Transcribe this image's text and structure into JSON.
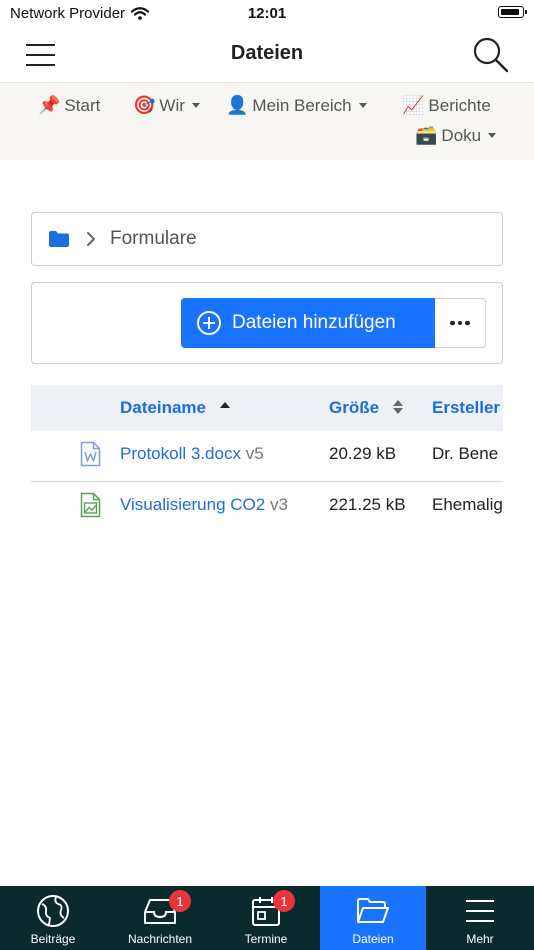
{
  "status_bar": {
    "carrier": "Network Provider",
    "time": "12:01",
    "battery_level": 0.9
  },
  "header": {
    "title": "Dateien"
  },
  "nav": {
    "items": [
      {
        "emoji": "📌",
        "label": "Start"
      },
      {
        "emoji": "🎯",
        "label": "Wir"
      },
      {
        "emoji": "👤",
        "label": "Mein Bereich"
      },
      {
        "emoji": "📈",
        "label": "Berichte"
      },
      {
        "emoji": "🗃️",
        "label": "Doku"
      }
    ]
  },
  "breadcrumb": {
    "current": "Formulare"
  },
  "toolbar": {
    "add_label": "Dateien hinzufügen"
  },
  "table": {
    "columns": {
      "name": "Dateiname",
      "size": "Größe",
      "creator": "Ersteller"
    },
    "rows": [
      {
        "name": "Protokoll 3.docx",
        "version": "v5",
        "size": "20.29 kB",
        "creator": "Dr. Bene",
        "icon": "word-document-icon"
      },
      {
        "name": "Visualisierung CO2",
        "version": "v3",
        "size": "221.25 kB",
        "creator": "Ehemalig",
        "icon": "image-file-icon"
      }
    ]
  },
  "tabbar": {
    "tabs": [
      {
        "label": "Beiträge",
        "icon": "globe-icon"
      },
      {
        "label": "Nachrichten",
        "icon": "inbox-icon",
        "badge": "1"
      },
      {
        "label": "Termine",
        "icon": "calendar-icon",
        "badge": "1"
      },
      {
        "label": "Dateien",
        "icon": "folder-open-icon",
        "active": true
      },
      {
        "label": "Mehr",
        "icon": "menu-icon"
      }
    ]
  },
  "colors": {
    "accent": "#1a73ff",
    "link": "#1a6fe0",
    "tabbar_bg": "#0b2a2e",
    "badge": "#e8343a"
  }
}
